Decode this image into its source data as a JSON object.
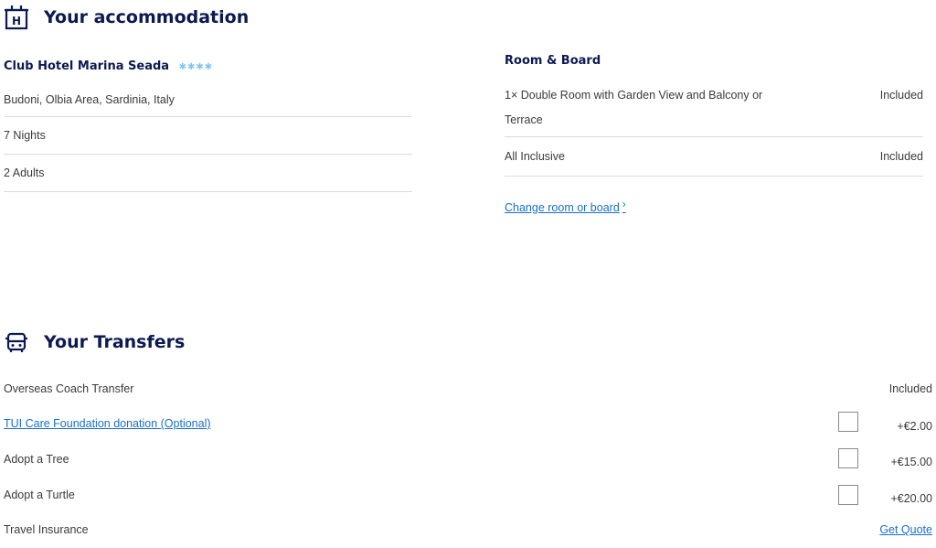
{
  "accommodation": {
    "title": "Your accommodation",
    "hotel_name": "Club Hotel Marina Seada",
    "stars": "✱✱✱✱",
    "location": "Budoni, Olbia Area, Sardinia, Italy",
    "nights": "7 Nights",
    "guests": "2  Adults"
  },
  "room_board": {
    "title": "Room & Board",
    "items": [
      {
        "desc": "1× Double Room with Garden View and Balcony or Terrace",
        "price": "Included"
      },
      {
        "desc": "All Inclusive",
        "price": "Included"
      }
    ],
    "change_link": "Change room or board",
    "chevron": "›"
  },
  "transfers": {
    "title": "Your Transfers",
    "rows": [
      {
        "label": "Overseas Coach Transfer",
        "value": "Included"
      },
      {
        "label": "TUI Care Foundation donation (Optional)",
        "value": "+€2.00"
      },
      {
        "label": "Adopt a Tree",
        "value": "+€15.00"
      },
      {
        "label": "Adopt a Turtle",
        "value": "+€20.00"
      },
      {
        "label": "Travel Insurance",
        "value": "Get Quote"
      }
    ]
  },
  "colors": {
    "brand": "#0c1a4f",
    "link": "#1a6fc9",
    "star": "#7fc7f0",
    "divider": "#dcdcdc"
  }
}
